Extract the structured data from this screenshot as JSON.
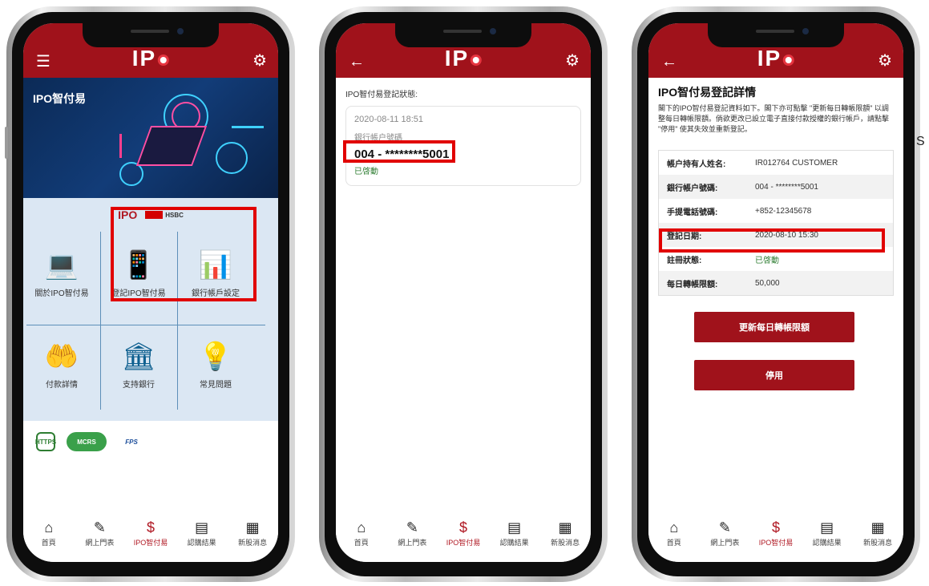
{
  "app": {
    "logo_text": "IP"
  },
  "tabbar": [
    {
      "label": "首頁",
      "icon": "home-icon",
      "glyph": "⌂"
    },
    {
      "label": "網上門表",
      "icon": "pen-icon",
      "glyph": "✎"
    },
    {
      "label": "IPO智付易",
      "icon": "dollar-icon",
      "glyph": "$"
    },
    {
      "label": "認購結果",
      "icon": "clipboard-icon",
      "glyph": "▤"
    },
    {
      "label": "新股消息",
      "icon": "newspaper-icon",
      "glyph": "▦"
    }
  ],
  "screen1": {
    "hero_title": "IPO智付易",
    "partner_ipo": "IPO",
    "partner_hsbc": "HSBC",
    "grid": [
      {
        "label": "關於IPO智付易",
        "icon": "laptop-chat-icon",
        "glyph": "💻"
      },
      {
        "label": "登記IPO智付易",
        "icon": "phone-gear-icon",
        "glyph": "📱"
      },
      {
        "label": "銀行帳戶設定",
        "icon": "bank-document-icon",
        "glyph": "📊"
      },
      {
        "label": "付款詳情",
        "icon": "hand-coin-icon",
        "glyph": "🤲"
      },
      {
        "label": "支持銀行",
        "icon": "bank-icon",
        "glyph": "🏛"
      },
      {
        "label": "常見問題",
        "icon": "head-lightbulb-icon",
        "glyph": "💡"
      }
    ],
    "badges": [
      "HTTPS",
      "MCRS",
      "FPS"
    ]
  },
  "screen2": {
    "status_title": "IPO智付易登記狀態:",
    "card": {
      "date": "2020-08-11 18:51",
      "account_label": "銀行帳户號碼",
      "account": "004 - ********5001",
      "status": "已啓動"
    }
  },
  "screen3": {
    "title": "IPO智付易登記詳情",
    "description": "閣下的IPO智付易登記資料如下。閣下亦可點擊 \"更新每日轉帳限額\" 以調整每日轉帳限額。倘欲更改已設立電子直接付款授權的銀行帳戶，請點擊 \"停用\" 使其失效並重新登記。",
    "rows": [
      {
        "key": "帳户持有人姓名:",
        "value": "IR012764 CUSTOMER"
      },
      {
        "key": "銀行帳户號碼:",
        "value": "004 - ********5001"
      },
      {
        "key": "手提電話號碼:",
        "value": "+852-12345678"
      },
      {
        "key": "登記日期:",
        "value": "2020-08-10 15:30"
      },
      {
        "key": "註冊狀態:",
        "value": "已啓動"
      },
      {
        "key": "每日轉帳限額:",
        "value": "50,000"
      }
    ],
    "update_button": "更新每日轉帳限額",
    "disable_button": "停用"
  },
  "stray_text": "S",
  "colors": {
    "brand": "#a0121b",
    "highlight": "#e10000",
    "panel": "#dbe7f3"
  }
}
